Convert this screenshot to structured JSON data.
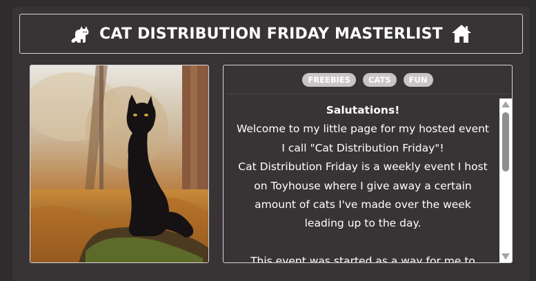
{
  "header": {
    "title": "CAT DISTRIBUTION FRIDAY MASTERLIST",
    "left_icon": "cat-icon",
    "right_icon": "home-icon"
  },
  "image": {
    "subject": "black-cat-photo"
  },
  "info": {
    "tags": [
      "FREEBIES",
      "CATS",
      "FUN"
    ],
    "greeting": "Salutations!",
    "lines": [
      "Welcome to my little page for my hosted event",
      "I call \"Cat Distribution Friday\"!",
      "Cat Distribution Friday is a weekly event I host",
      "on Toyhouse where I give away a certain",
      "amount of cats I've made over the week",
      "leading up to the day.",
      "",
      "This event was started as a way for me to"
    ]
  },
  "colors": {
    "background": "#2f2c2e",
    "panel": "#383436",
    "border": "#d9d6d7",
    "tag": "#c8c5c6",
    "text": "#ffffff"
  }
}
